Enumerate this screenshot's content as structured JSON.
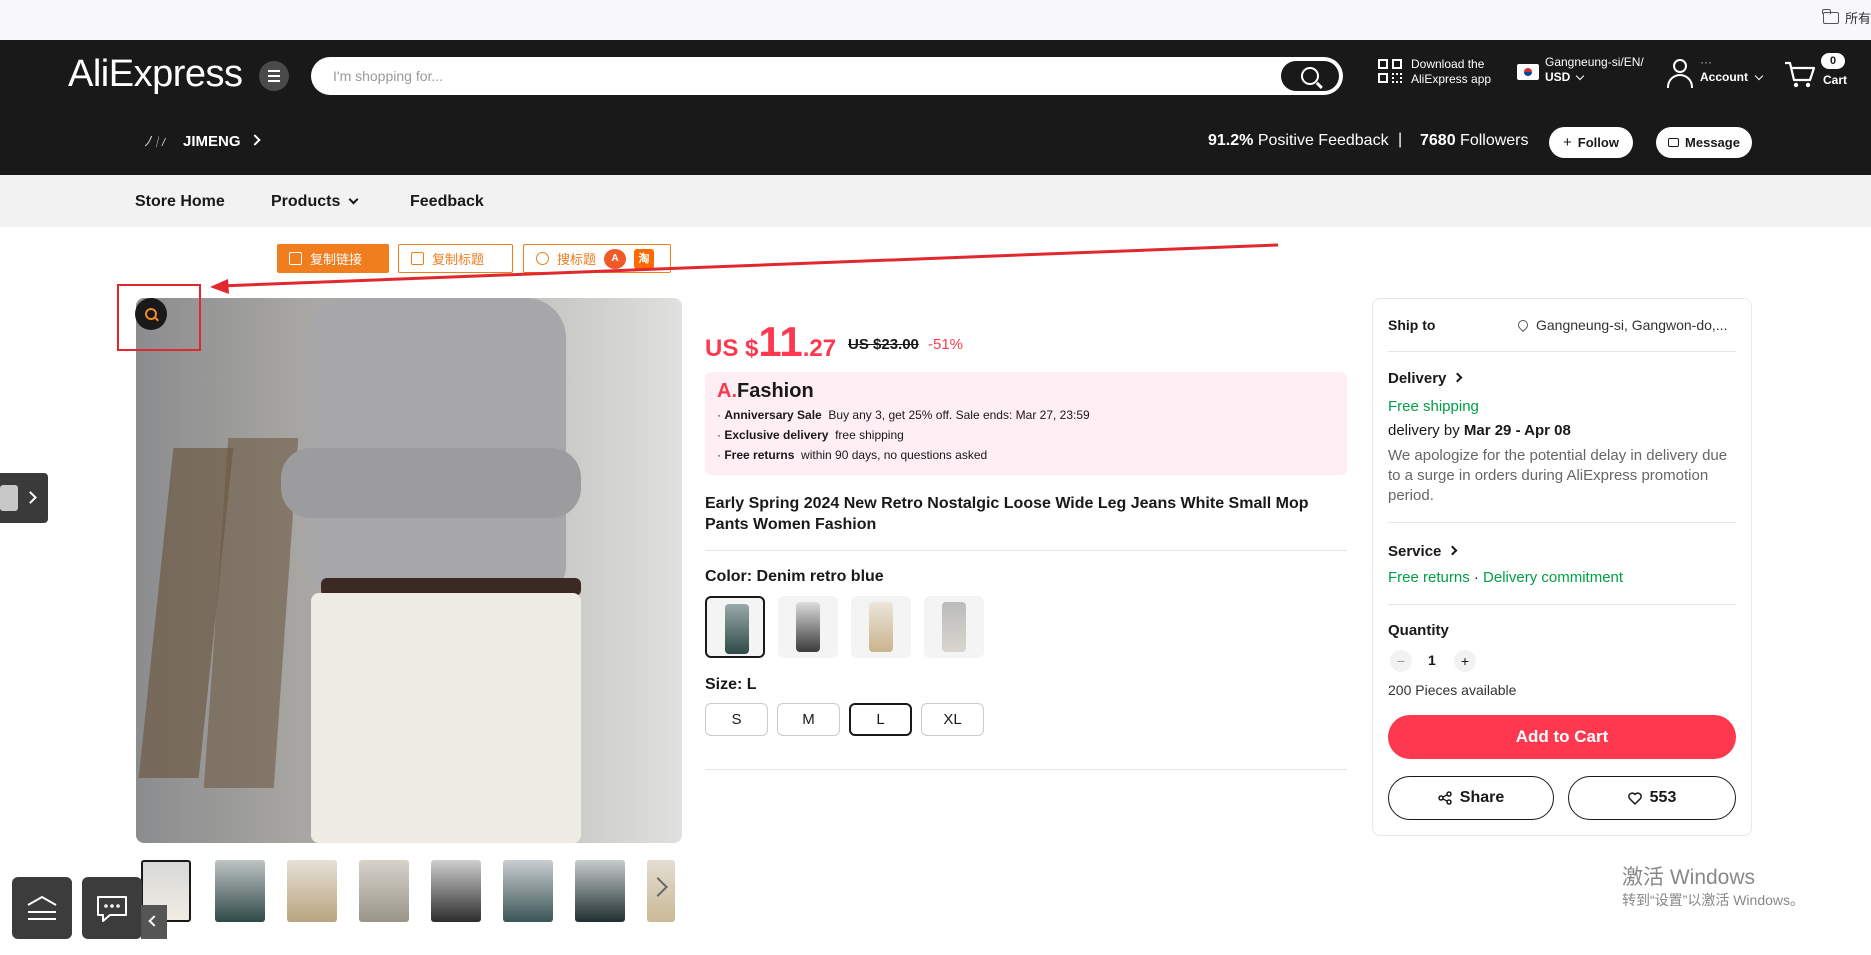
{
  "browser": {
    "bookmark_label": "所有"
  },
  "header": {
    "logo": "AliExpress",
    "search_placeholder": "I'm shopping for...",
    "download_line1": "Download the",
    "download_line2": "AliExpress app",
    "region_line1": "Gangneung-si/EN/",
    "region_line2": "USD",
    "account_line1": "···",
    "account_line2": "Account",
    "cart_count": "0",
    "cart_label": "Cart"
  },
  "store": {
    "name": "JIMENG",
    "feedback_pct": "91.2%",
    "feedback_label": "Positive Feedback",
    "followers_count": "7680",
    "followers_label": "Followers",
    "follow_label": "Follow",
    "message_label": "Message"
  },
  "store_nav": [
    "Store Home",
    "Products",
    "Feedback"
  ],
  "tools": {
    "copy_link": "复制链接",
    "copy_title": "复制标题",
    "search_title": "搜标题",
    "ali_badge": "A",
    "tao_badge": "淘"
  },
  "product": {
    "price_currency": "US $",
    "price_int": "11",
    "price_dec": ".27",
    "old_price": "US $23.00",
    "discount": "-51%",
    "promo_brand_a": "A.",
    "promo_brand": "Fashion",
    "promo": [
      {
        "title": "Anniversary Sale",
        "text": "Buy any 3, get 25% off. Sale ends: Mar 27, 23:59"
      },
      {
        "title": "Exclusive delivery",
        "text": "free shipping"
      },
      {
        "title": "Free returns",
        "text": "within 90 days, no questions asked"
      }
    ],
    "title": "Early Spring 2024 New Retro Nostalgic Loose Wide Leg Jeans White Small Mop Pants Women Fashion",
    "color_label": "Color: Denim retro blue",
    "size_label": "Size: L",
    "sizes": [
      "S",
      "M",
      "L",
      "XL"
    ],
    "selected_size": "L"
  },
  "panel": {
    "ship_to_label": "Ship to",
    "ship_to_value": "Gangneung-si, Gangwon-do,...",
    "delivery_label": "Delivery",
    "free_shipping": "Free shipping",
    "delivery_by": "delivery by",
    "delivery_dates": "Mar 29 - Apr 08",
    "delay_note": "We apologize for the potential delay in delivery due to a surge in orders during AliExpress promotion period.",
    "service_label": "Service",
    "free_returns": "Free returns",
    "dot": "·",
    "delivery_commitment": "Delivery commitment",
    "quantity_label": "Quantity",
    "quantity": "1",
    "minus": "−",
    "plus": "+",
    "available": "200 Pieces available",
    "add_to_cart": "Add to Cart",
    "share": "Share",
    "wishlist_count": "553"
  },
  "watermark": {
    "line1": "激活 Windows",
    "line2": "转到“设置”以激活 Windows。"
  },
  "colors": {
    "accent": "#fd384f",
    "header_bg": "#191919",
    "tool_orange": "#f07d1e",
    "green": "#00a046"
  }
}
